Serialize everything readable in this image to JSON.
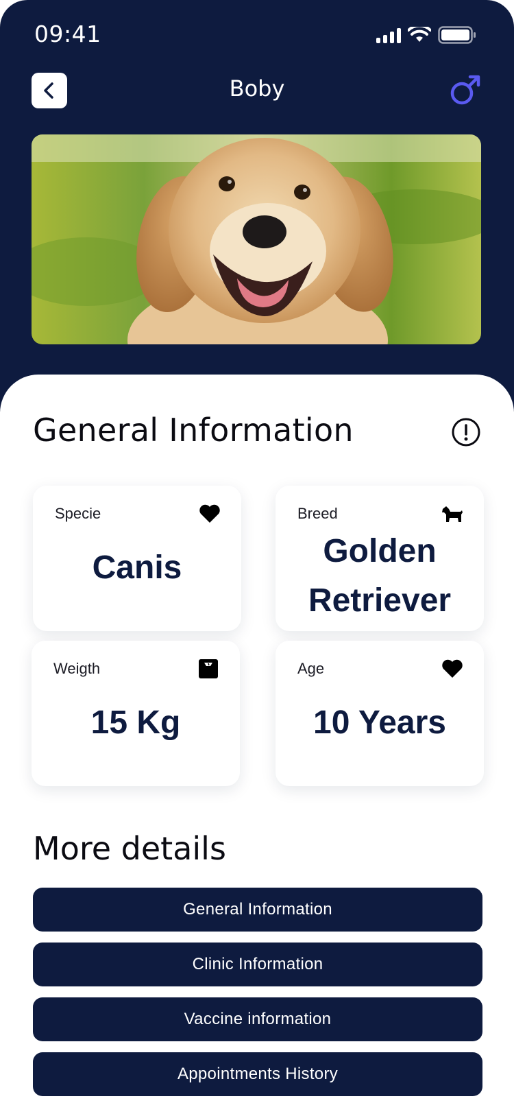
{
  "status_bar": {
    "time": "09:41"
  },
  "header": {
    "title": "Boby",
    "gender_icon": "male-icon",
    "back_icon": "chevron-left-icon"
  },
  "photo": {
    "alt": "golden retriever photo"
  },
  "general": {
    "title": "General Information",
    "info_icon": "info-alert-icon",
    "cards": [
      {
        "label": "Specie",
        "value": "Canis",
        "icon": "heart-icon"
      },
      {
        "label": "Breed",
        "value_line1": "Golden",
        "value_line2": "Retriever",
        "icon": "dog-icon"
      },
      {
        "label": "Weigth",
        "value": "15 Kg",
        "icon": "scale-icon"
      },
      {
        "label": "Age",
        "value": "10 Years",
        "icon": "heart-icon"
      }
    ]
  },
  "more_details": {
    "title": "More details",
    "buttons": [
      "General Information",
      "Clinic Information",
      "Vaccine information",
      "Appointments History"
    ]
  },
  "colors": {
    "navy": "#0e1b3f",
    "accent": "#5a5af0",
    "white": "#ffffff"
  }
}
